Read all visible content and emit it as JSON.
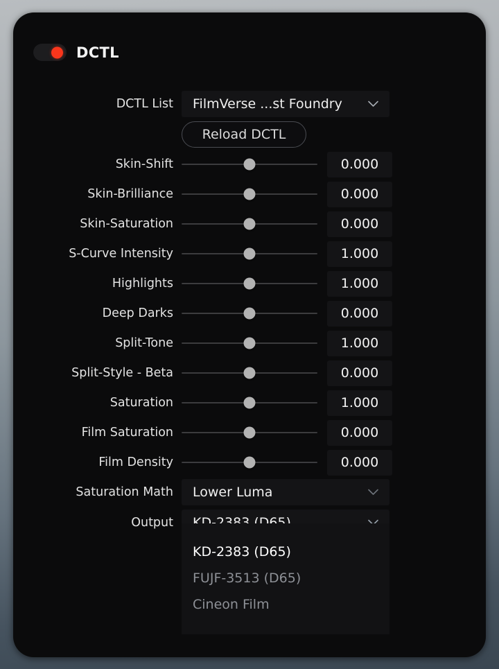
{
  "panel": {
    "title": "DCTL",
    "toggle_state": "on",
    "accent_color": "#f8361c"
  },
  "dctl_list": {
    "label": "DCTL List",
    "value": "FilmVerse ...st Foundry",
    "chevron": "chevron-down-icon"
  },
  "reload": {
    "label": "Reload DCTL"
  },
  "sliders": [
    {
      "label": "Skin-Shift",
      "value": "0.000",
      "handle_pct": 50
    },
    {
      "label": "Skin-Brilliance",
      "value": "0.000",
      "handle_pct": 50
    },
    {
      "label": "Skin-Saturation",
      "value": "0.000",
      "handle_pct": 50
    },
    {
      "label": "S-Curve Intensity",
      "value": "1.000",
      "handle_pct": 50
    },
    {
      "label": "Highlights",
      "value": "1.000",
      "handle_pct": 50
    },
    {
      "label": "Deep Darks",
      "value": "0.000",
      "handle_pct": 50
    },
    {
      "label": "Split-Tone",
      "value": "1.000",
      "handle_pct": 50
    },
    {
      "label": "Split-Style - Beta",
      "value": "0.000",
      "handle_pct": 50
    },
    {
      "label": "Saturation",
      "value": "1.000",
      "handle_pct": 50
    },
    {
      "label": "Film Saturation",
      "value": "0.000",
      "handle_pct": 50
    },
    {
      "label": "Film Density",
      "value": "0.000",
      "handle_pct": 50
    }
  ],
  "saturation_math": {
    "label": "Saturation Math",
    "value": "Lower Luma",
    "chevron": "chevron-down-icon"
  },
  "output": {
    "label": "Output",
    "value": "KD-2383 (D65)",
    "chevron": "chevron-down-icon",
    "open": true,
    "options": [
      {
        "label": "KD-2383 (D65)",
        "selected": true
      },
      {
        "label": "FUJF-3513 (D65)",
        "selected": false
      },
      {
        "label": "Cineon Film",
        "selected": false
      }
    ]
  }
}
